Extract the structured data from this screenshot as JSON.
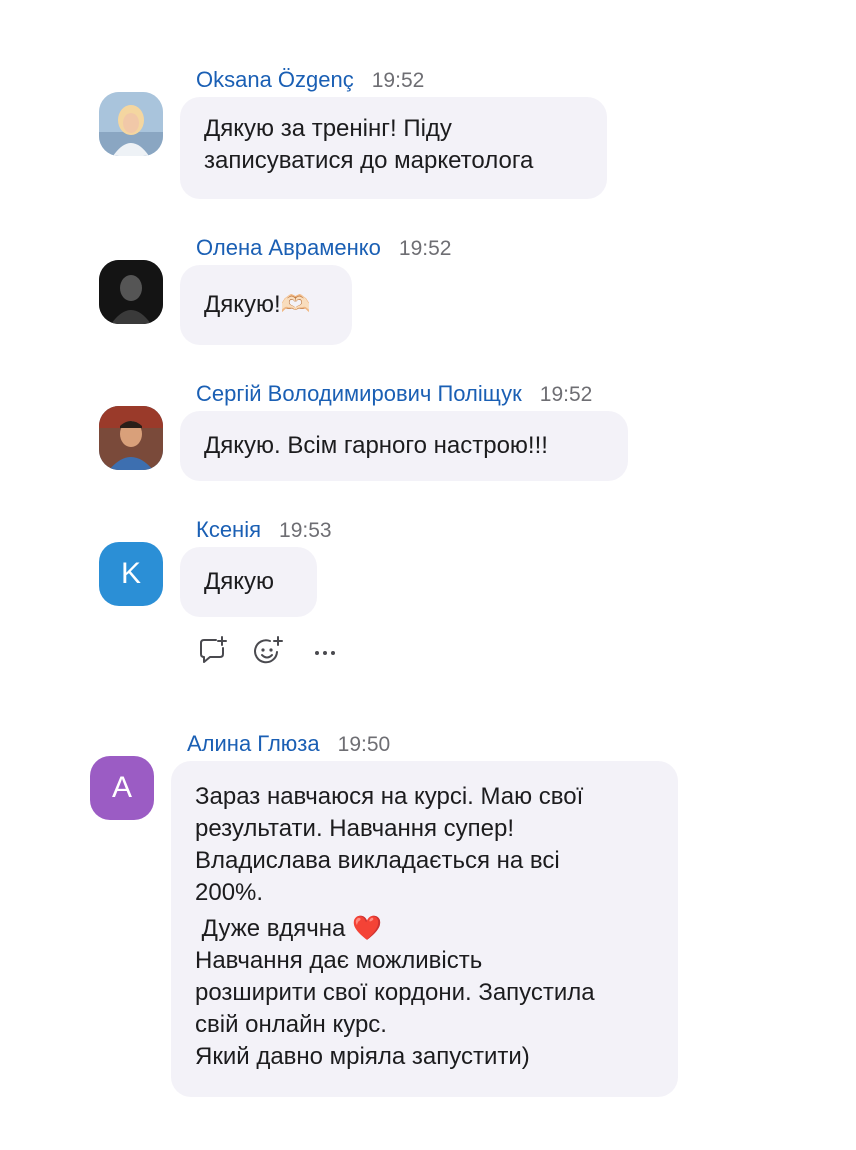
{
  "messages": [
    {
      "sender": "Oksana Özgenç",
      "time": "19:52",
      "text": "Дякую за тренінг! Піду записуватися до маркетолога",
      "lines": [
        "Дякую за тренінг! Піду",
        "записуватися до маркетолога"
      ],
      "avatar": "photo-woman"
    },
    {
      "sender": "Олена Авраменко",
      "time": "19:52",
      "text": "Дякую!🫶🏻",
      "avatar": "photo-dark"
    },
    {
      "sender": "Сергій Володимирович Поліщук",
      "time": "19:52",
      "text": "Дякую. Всім гарного настрою!!!",
      "avatar": "photo-man"
    },
    {
      "sender": "Ксенія",
      "time": "19:53",
      "text": "Дякую",
      "avatar_letter": "K",
      "avatar_color": "#2b8fd6"
    },
    {
      "sender": "Алина Глюза",
      "time": "19:50",
      "avatar_letter": "A",
      "avatar_color": "#9b5cc4",
      "paragraphs": [
        [
          "Зараз навчаюся на курсі. Маю свої",
          "результати. Навчання супер!",
          "Владислава викладається на всі",
          "200%."
        ],
        [
          " Дуже вдячна ❤️"
        ],
        [
          "Навчання  дає можливість",
          "розширити свої кордони. Запустила",
          "свій онлайн курс.",
          "Який давно мріяла запустити)"
        ]
      ]
    }
  ],
  "actions": {
    "reply_icon": "reply-plus-icon",
    "react_icon": "emoji-plus-icon",
    "more_icon": "more-icon"
  },
  "colors": {
    "sender": "#1a5fb4",
    "bubble": "#f3f2f8",
    "time": "#6e6e73"
  }
}
